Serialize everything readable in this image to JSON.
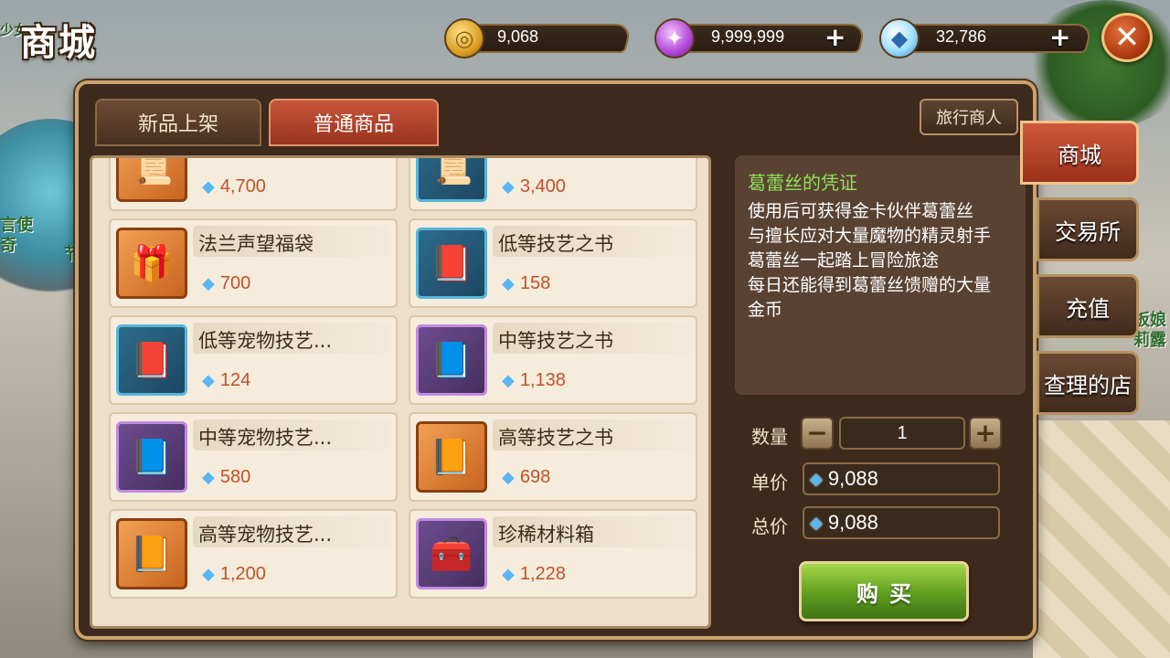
{
  "title": "商城",
  "currencies": {
    "gold": {
      "icon": "gold-coin-icon",
      "value": "9,068"
    },
    "purple": {
      "icon": "purple-gem-icon",
      "value": "9,999,999"
    },
    "diamond": {
      "icon": "diamond-icon",
      "value": "32,786"
    }
  },
  "background": {
    "left_text_1": "少女",
    "left_text_2": "言使",
    "left_text_3": "奇",
    "left_text_4": "节",
    "right_text_1": "板娘",
    "right_text_2": "莉露"
  },
  "tabs": {
    "new": "新品上架",
    "normal": "普通商品",
    "traveler": "旅行商人"
  },
  "items": [
    {
      "name": "",
      "price": "4,700",
      "color": "orange"
    },
    {
      "name": "",
      "price": "3,400",
      "color": "blue"
    },
    {
      "name": "法兰声望福袋",
      "price": "700",
      "color": "orange"
    },
    {
      "name": "低等技艺之书",
      "price": "158",
      "color": "blue"
    },
    {
      "name": "低等宠物技艺...",
      "price": "124",
      "color": "blue"
    },
    {
      "name": "中等技艺之书",
      "price": "1,138",
      "color": "purple"
    },
    {
      "name": "中等宠物技艺...",
      "price": "580",
      "color": "purple"
    },
    {
      "name": "高等技艺之书",
      "price": "698",
      "color": "orange"
    },
    {
      "name": "高等宠物技艺...",
      "price": "1,200",
      "color": "orange"
    },
    {
      "name": "珍稀材料箱",
      "price": "1,228",
      "color": "purple"
    }
  ],
  "detail": {
    "title": "葛蕾丝的凭证",
    "lines": [
      "使用后可获得金卡伙伴葛蕾丝",
      "与擅长应对大量魔物的精灵射手",
      "葛蕾丝一起踏上冒险旅途",
      "每日还能得到葛蕾丝馈赠的大量",
      "金币"
    ]
  },
  "purchase": {
    "qty_label": "数量",
    "qty_value": "1",
    "unit_label": "单价",
    "unit_price": "9,088",
    "total_label": "总价",
    "total_price": "9,088",
    "buy_label": "购买"
  },
  "side_tabs": [
    "商城",
    "交易所",
    "充值",
    "查理的店"
  ],
  "colors": {
    "accent_red": "#c9553a",
    "buy_green": "#5f9e1f",
    "price_text": "#c2512a",
    "detail_title": "#8ee25a"
  }
}
